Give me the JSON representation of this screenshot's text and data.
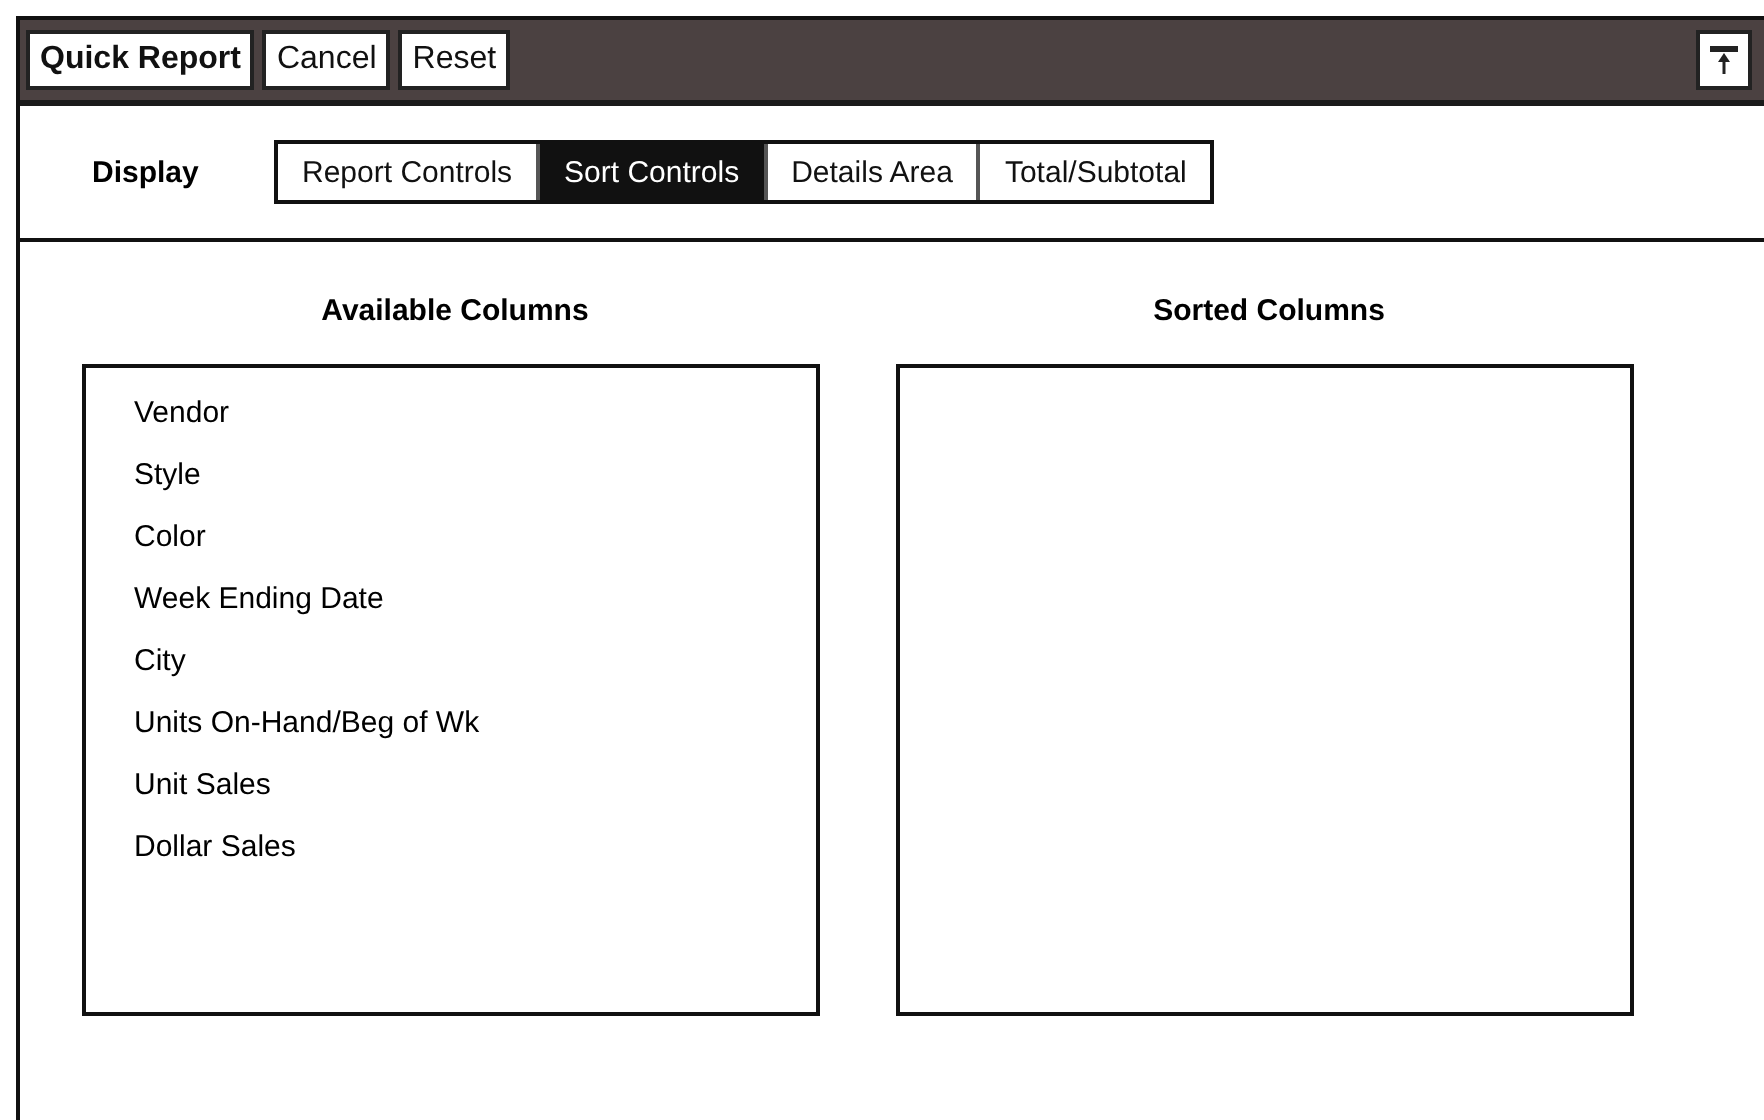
{
  "toolbar": {
    "buttons": [
      "Quick Report",
      "Cancel",
      "Reset"
    ]
  },
  "display": {
    "label": "Display",
    "tabs": [
      {
        "label": "Report Controls",
        "selected": false
      },
      {
        "label": "Sort Controls",
        "selected": true
      },
      {
        "label": "Details Area",
        "selected": false
      },
      {
        "label": "Total/Subtotal",
        "selected": false
      }
    ]
  },
  "available_columns": {
    "title": "Available Columns",
    "items": [
      "Vendor",
      "Style",
      "Color",
      "Week Ending Date",
      "City",
      "Units On-Hand/Beg of Wk",
      "Unit Sales",
      "Dollar Sales"
    ]
  },
  "sorted_columns": {
    "title": "Sorted Columns"
  }
}
